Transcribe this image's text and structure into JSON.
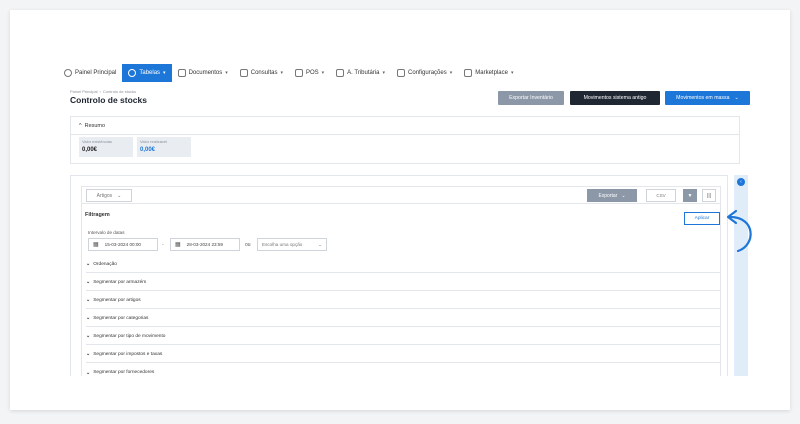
{
  "nav": {
    "items": [
      {
        "label": "Painel Principal",
        "icon": "clock-icon",
        "has_menu": false,
        "active": false
      },
      {
        "label": "Tabelas",
        "icon": "users-icon",
        "has_menu": true,
        "active": true
      },
      {
        "label": "Documentos",
        "icon": "document-icon",
        "has_menu": true,
        "active": false
      },
      {
        "label": "Consultas",
        "icon": "chart-icon",
        "has_menu": true,
        "active": false
      },
      {
        "label": "POS",
        "icon": "pos-icon",
        "has_menu": true,
        "active": false
      },
      {
        "label": "A. Tributária",
        "icon": "tax-icon",
        "has_menu": true,
        "active": false
      },
      {
        "label": "Configurações",
        "icon": "settings-icon",
        "has_menu": true,
        "active": false
      },
      {
        "label": "Marketplace",
        "icon": "grid-icon",
        "has_menu": true,
        "active": false
      }
    ]
  },
  "breadcrumb": {
    "home": "Painel Principal",
    "current": "Controlo de stocks"
  },
  "page_title": "Controlo de stocks",
  "actions": {
    "export_inventory": "Exportar Inventário",
    "old_movements": "Movimentos sistema antigo",
    "bulk_movements": "Movimentos em massa"
  },
  "resumo": {
    "title": "Resumo",
    "stats": [
      {
        "label": "Valor existências",
        "value": "0,00€",
        "color": "#1d2430"
      },
      {
        "label": "Valor realizável",
        "value": "0,00€",
        "color": "#1d77d8"
      }
    ]
  },
  "toolbar": {
    "artigos_select": "Artigos",
    "export_label": "Exportar",
    "csv_label": "CSV"
  },
  "filters": {
    "title": "Filtragem",
    "apply_label": "Aplicar",
    "date_interval_label": "Intervalo de datas",
    "date_from": "15-03-2024 00:00",
    "date_to": "28-03-2024 23:59",
    "or_label": "ou",
    "preset_placeholder": "Escolha uma opção",
    "sections": [
      "Ordenação",
      "Segmentar por armazém",
      "Segmentar por artigos",
      "Segmentar por categorias",
      "Segmentar por tipo de movimento",
      "Segmentar por impostos e taxas",
      "Segmentar por fornecedores"
    ]
  },
  "colors": {
    "accent": "#1d77d8",
    "dark_button": "#1f2733",
    "grey_button": "#8c97a8"
  }
}
